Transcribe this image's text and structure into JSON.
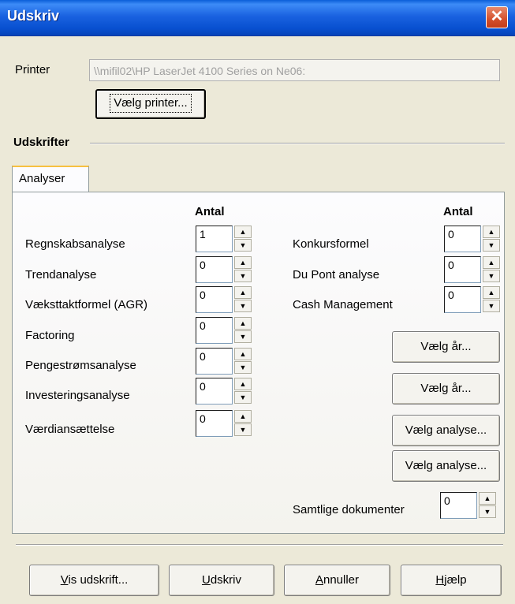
{
  "window": {
    "title": "Udskriv",
    "close_glyph": "✕"
  },
  "printer": {
    "label": "Printer",
    "value": "\\\\mifil02\\HP LaserJet 4100 Series on Ne06:",
    "choose_button": "Vælg printer..."
  },
  "section": {
    "label": "Udskrifter"
  },
  "tabs": [
    {
      "label": "Analyser",
      "active": true
    }
  ],
  "columns": {
    "left_header": "Antal",
    "right_header": "Antal"
  },
  "left_items": [
    {
      "label": "Regnskabsanalyse",
      "count": "1"
    },
    {
      "label": "Trendanalyse",
      "count": "0"
    },
    {
      "label": "Væksttaktformel (AGR)",
      "count": "0"
    },
    {
      "label": "Factoring",
      "count": "0"
    },
    {
      "label": "Pengestrømsanalyse",
      "count": "0"
    },
    {
      "label": "Investeringsanalyse",
      "count": "0"
    },
    {
      "label": "Værdiansættelse",
      "count": "0"
    }
  ],
  "right_items": [
    {
      "label": "Konkursformel",
      "count": "0"
    },
    {
      "label": "Du Pont analyse",
      "count": "0"
    },
    {
      "label": "Cash Management",
      "count": "0"
    }
  ],
  "right_buttons": [
    "Vælg år...",
    "Vælg år...",
    "Vælg analyse...",
    "Vælg analyse..."
  ],
  "all_docs": {
    "label": "Samtlige dokumenter",
    "count": "0"
  },
  "spinner": {
    "up_glyph": "▲",
    "down_glyph": "▼"
  },
  "footer_buttons": {
    "preview": {
      "mnemonic": "V",
      "rest": "is udskrift..."
    },
    "print": {
      "mnemonic": "U",
      "rest": "dskriv"
    },
    "cancel": {
      "mnemonic": "A",
      "rest": "nnuller"
    },
    "help": {
      "mnemonic": "H",
      "rest": "jælp"
    }
  },
  "colors": {
    "title_bar": "#1a62e0",
    "dialog_bg": "#ece9d8",
    "tab_highlight": "#f6c040",
    "close_button": "#d4502c"
  }
}
